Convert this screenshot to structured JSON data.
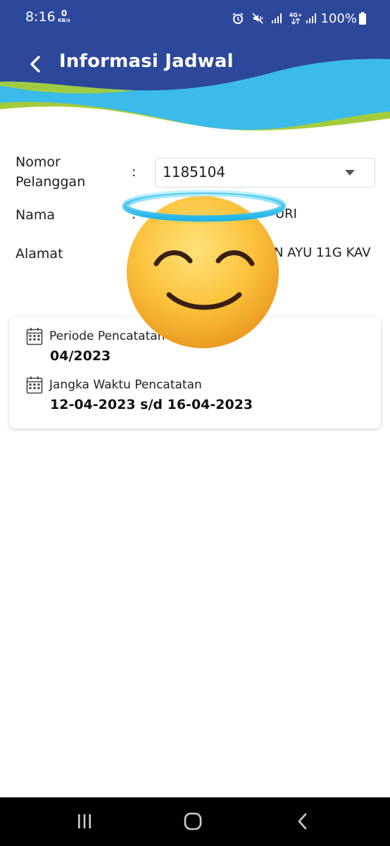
{
  "status_bar": {
    "time": "8:16",
    "net_speed_value": "0",
    "net_speed_unit": "KB/s",
    "network_type": "4G+",
    "battery": "100%",
    "icons": [
      "alarm-icon",
      "mute-vibrate-icon",
      "signal-icon",
      "signal-icon",
      "battery-icon"
    ]
  },
  "header": {
    "title": "Informasi Jadwal",
    "back_icon": "chevron-left-icon",
    "colors": {
      "blue": "#2d479b",
      "light_blue": "#3bbbe9",
      "green": "#a4cc3a"
    }
  },
  "form": {
    "separator": ":",
    "customer_number": {
      "label_line1": "Nomor",
      "label_line2": "Pelanggan",
      "selected_value": "1185104"
    },
    "name": {
      "label": "Nama",
      "value": "URI"
    },
    "address": {
      "label": "Alamat",
      "value": "N AYU 11G KAV"
    }
  },
  "schedule_card": {
    "period_label": "Periode Pencatatan",
    "period_value": "04/2023",
    "window_label": "Jangka Waktu Pencatatan",
    "window_value": "12-04-2023 s/d 16-04-2023",
    "item_icon": "calendar-icon"
  },
  "overlay": {
    "emoji": "smiling-face-with-halo"
  },
  "nav_bar": {
    "items": [
      "recent-apps-icon",
      "home-icon",
      "back-icon"
    ]
  }
}
